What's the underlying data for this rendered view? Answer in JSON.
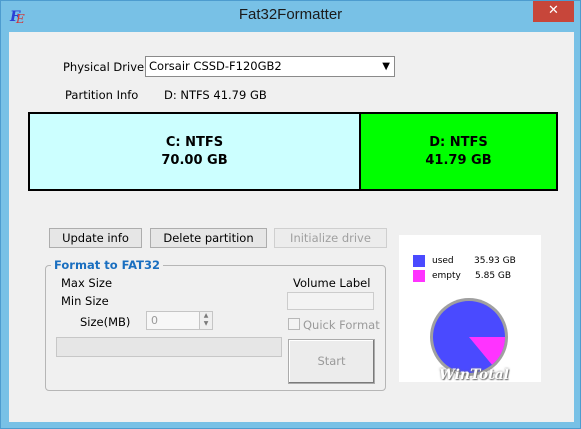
{
  "window": {
    "title": "Fat32Formatter",
    "app_icon": "fat32-app-icon",
    "close_label": "✕"
  },
  "drive": {
    "physical_drive_label": "Physical Drive",
    "selected": "Corsair CSSD-F120GB2",
    "partition_info_label": "Partition Info",
    "partition_info_value": "D: NTFS  41.79 GB"
  },
  "partitions": [
    {
      "name": "C: NTFS",
      "size": "70.00 GB",
      "color": "#ccffff"
    },
    {
      "name": "D: NTFS",
      "size": "41.79 GB",
      "color": "#00ff00"
    }
  ],
  "buttons": {
    "update_info": "Update info",
    "delete_partition": "Delete partition",
    "initialize_drive": "Initialize drive"
  },
  "format": {
    "group_title": "Format to FAT32",
    "max_size_label": "Max Size",
    "min_size_label": "Min Size",
    "size_label": "Size(MB)",
    "size_value": "0",
    "volume_label": "Volume Label",
    "quick_format_label": "Quick Format",
    "start_label": "Start"
  },
  "pie": {
    "used_label": "used",
    "used_value": "35.93 GB",
    "used_color": "#4a4aff",
    "empty_label": "empty",
    "empty_value": "5.85 GB",
    "empty_color": "#ff33ff",
    "watermark": "WinTotal",
    "used_fraction": 0.86
  }
}
